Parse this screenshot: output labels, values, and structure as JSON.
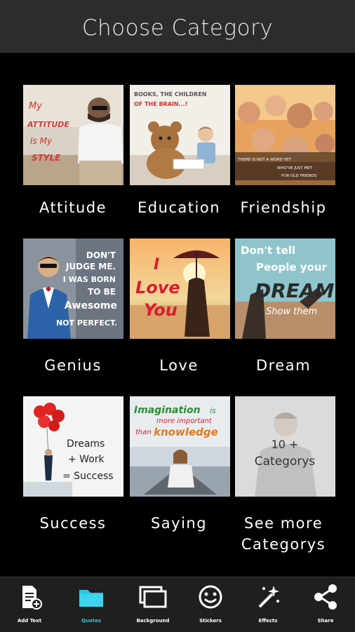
{
  "header": {
    "title": "Choose Category"
  },
  "categories": [
    {
      "label": "Attitude",
      "art": [
        "My",
        "ATTITUDE",
        "Is My",
        "STYLE"
      ]
    },
    {
      "label": "Education",
      "art": [
        "BOOKS, THE CHILDREN",
        "OF THE BRAIN...!"
      ]
    },
    {
      "label": "Friendship",
      "art": [
        "THERE IS NOT A WORD YET",
        "WHO'VE JUST MET",
        "FOR OLD FRIENDS"
      ]
    },
    {
      "label": "Genius",
      "art": [
        "DON'T",
        "JUDGE ME.",
        "I WAS BORN",
        "TO BE",
        "Awesome",
        "NOT PERFECT."
      ]
    },
    {
      "label": "Love",
      "art": [
        "I",
        "Love",
        "You"
      ]
    },
    {
      "label": "Dream",
      "art": [
        "Don't tell",
        "People your",
        "DREAM",
        "Show them"
      ]
    },
    {
      "label": "Success",
      "art": [
        "Dreams",
        "+ Work",
        "= Success"
      ]
    },
    {
      "label": "Saying",
      "art": [
        "Imagination",
        "is",
        "more important",
        "than",
        "knowledge"
      ]
    },
    {
      "label": "See more Categorys",
      "label_line1": "See more",
      "label_line2": "Categorys",
      "art": [
        "10 +",
        "Categorys"
      ]
    }
  ],
  "bottom_nav": [
    {
      "label": "Add Text",
      "icon": "add-text-icon"
    },
    {
      "label": "Quotes",
      "icon": "folder-icon",
      "active": true
    },
    {
      "label": "Background",
      "icon": "background-icon"
    },
    {
      "label": "Stickers",
      "icon": "smiley-icon"
    },
    {
      "label": "Effects",
      "icon": "magic-wand-icon"
    },
    {
      "label": "Share",
      "icon": "share-icon"
    }
  ],
  "colors": {
    "accent": "#2ec7e6",
    "header_bg": "#2c2c2c",
    "background": "#000000",
    "nav_bg": "#1f1f1f"
  }
}
